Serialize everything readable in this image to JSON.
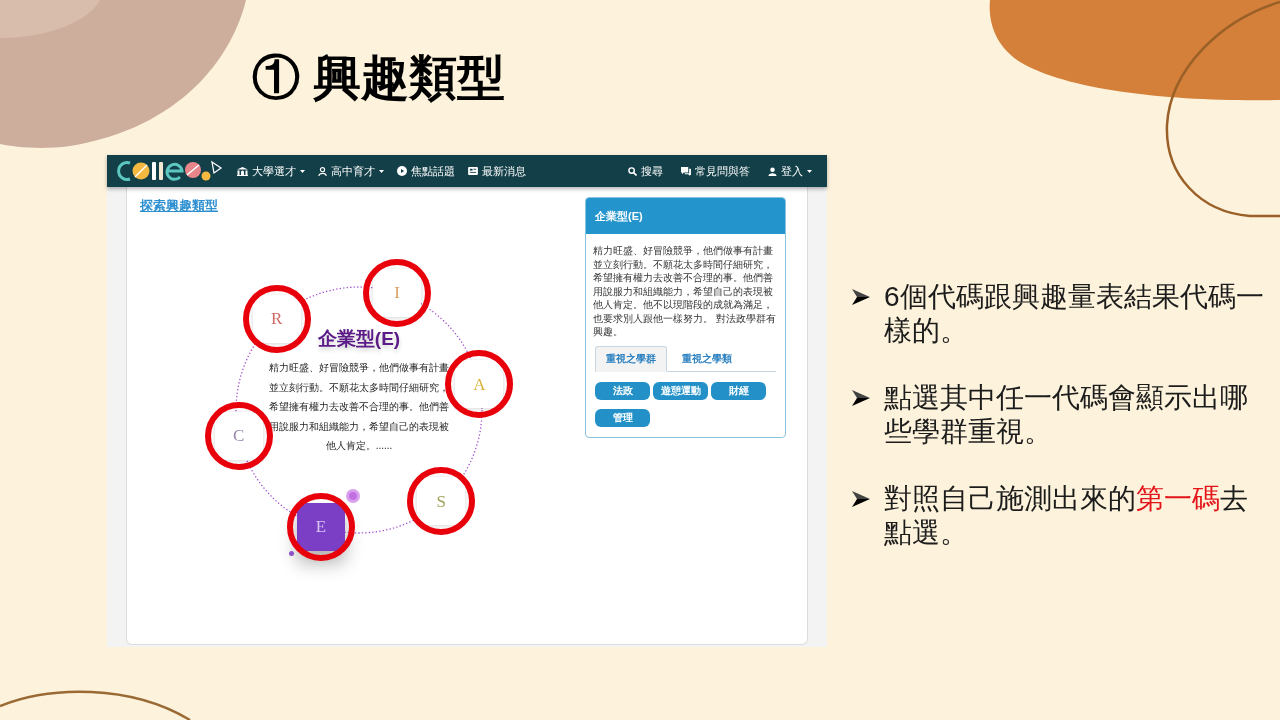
{
  "slide": {
    "title": "① 興趣類型"
  },
  "screenshot": {
    "navbar": {
      "left_items": [
        {
          "label": "大學選才",
          "dropdown": true
        },
        {
          "label": "高中育才",
          "dropdown": true
        },
        {
          "label": "焦點話題",
          "dropdown": false
        },
        {
          "label": "最新消息",
          "dropdown": false
        }
      ],
      "right_items": [
        {
          "label": "搜尋",
          "dropdown": false
        },
        {
          "label": "常見問與答",
          "dropdown": false
        },
        {
          "label": "登入",
          "dropdown": true
        }
      ]
    },
    "page_link": "探索興趣類型",
    "diagram": {
      "nodes": [
        {
          "letter": "R",
          "color": "#cf6b66",
          "selected": false,
          "circled": true
        },
        {
          "letter": "I",
          "color": "#d9a060",
          "selected": false,
          "circled": true
        },
        {
          "letter": "A",
          "color": "#d9b23c",
          "selected": false,
          "circled": true
        },
        {
          "letter": "S",
          "color": "#a3a35c",
          "selected": false,
          "circled": true
        },
        {
          "letter": "E",
          "color": "#7b3fc6",
          "selected": true,
          "circled": true
        },
        {
          "letter": "C",
          "color": "#9a86ad",
          "selected": false,
          "circled": true
        }
      ],
      "center_title": "企業型(E)",
      "description": "精力旺盛、好冒險競爭，他們做事有計畫並立刻行動。不願花太多時間仔細研究，希望擁有權力去改善不合理的事。他們善用說服力和組織能力，希望自己的表現被他人肯定。......"
    },
    "detail_card": {
      "title": "企業型(E)",
      "description": "精力旺盛、好冒險競爭，他們做事有計畫並立刻行動。不願花太多時間仔細研究，希望擁有權力去改善不合理的事。他們善用說服力和組織能力，希望自己的表現被他人肯定。他不以現階段的成就為滿足，也要求別人跟他一樣努力。 對法政學群有興趣。",
      "tabs": [
        {
          "label": "重視之學群",
          "selected": true
        },
        {
          "label": "重視之學類",
          "selected": false
        }
      ],
      "tags": [
        "法政",
        "遊憩運動",
        "財經",
        "管理"
      ]
    }
  },
  "bullets": [
    {
      "segments": [
        {
          "text": "6個代碼跟興趣量表結果代碼一樣的。",
          "highlight": false
        }
      ]
    },
    {
      "segments": [
        {
          "text": "點選其中任一代碼會顯示出哪些學群重視。",
          "highlight": false
        }
      ]
    },
    {
      "segments": [
        {
          "text": "對照自己施測出來的",
          "highlight": false
        },
        {
          "text": "第一碼",
          "highlight": true
        },
        {
          "text": "去點選。",
          "highlight": false
        }
      ]
    }
  ]
}
